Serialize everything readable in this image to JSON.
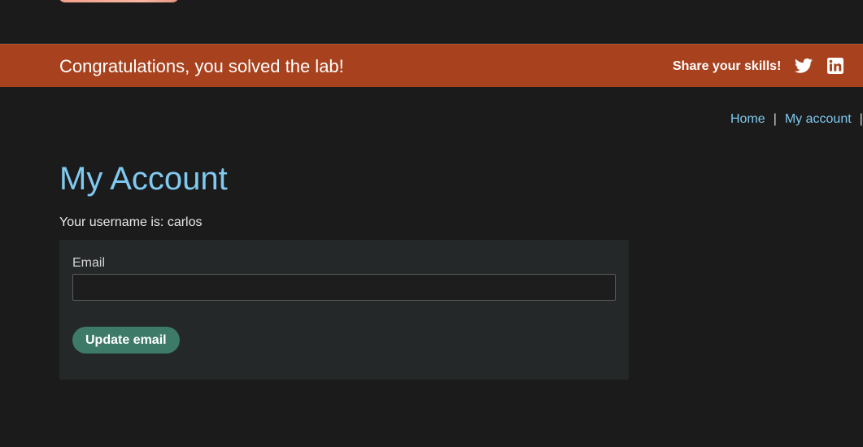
{
  "banner": {
    "message": "Congratulations, you solved the lab!",
    "share_label": "Share your skills!",
    "twitter_icon": "twitter-icon",
    "linkedin_icon": "linkedin-icon"
  },
  "nav": {
    "home": "Home",
    "separator": "|",
    "my_account": "My account"
  },
  "main": {
    "title": "My Account",
    "username_line": "Your username is: carlos"
  },
  "form": {
    "email_label": "Email",
    "email_value": "",
    "update_button": "Update email"
  },
  "colors": {
    "background": "#1b1b1b",
    "banner": "#a8421e",
    "link": "#7fc8ef",
    "title": "#80c9f0",
    "panel": "#252828",
    "button": "#3d7b68"
  }
}
